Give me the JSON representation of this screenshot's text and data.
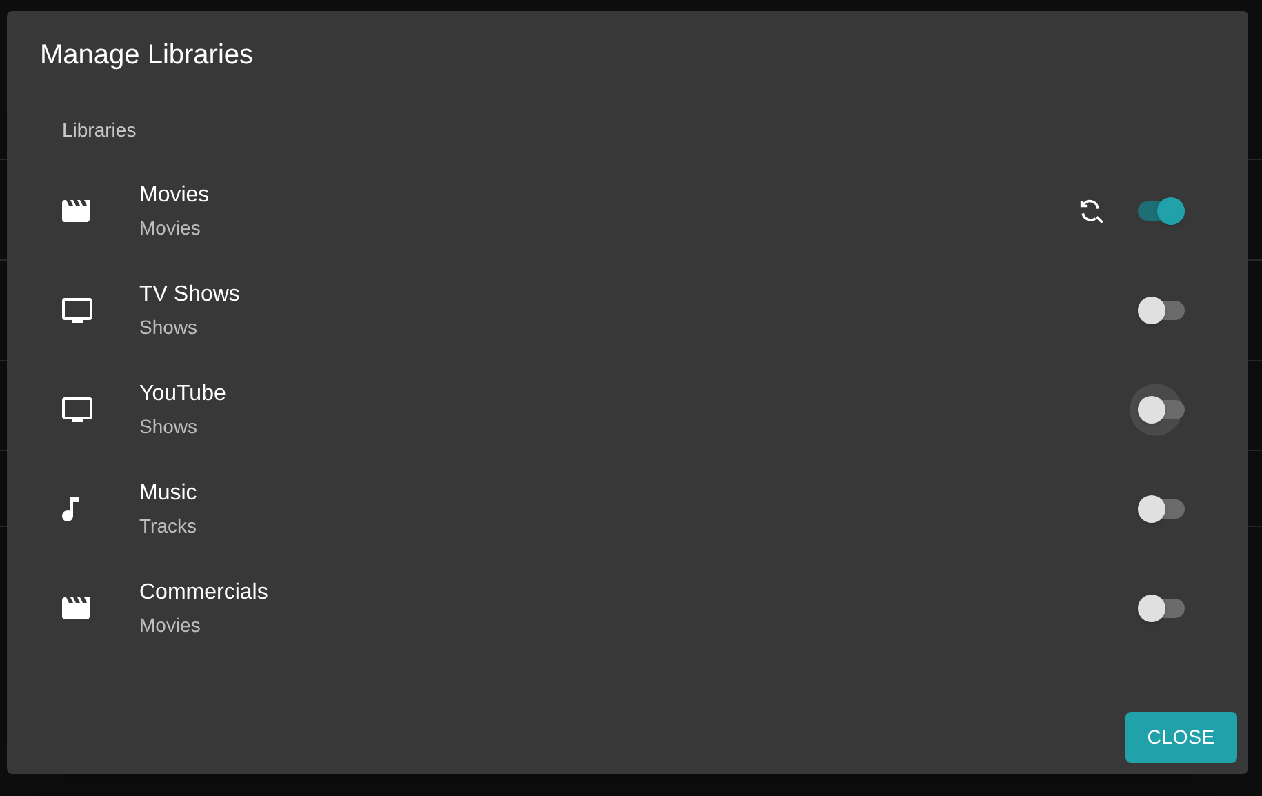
{
  "dialog": {
    "title": "Manage Libraries",
    "section_label": "Libraries",
    "libraries": [
      {
        "kind": "movies",
        "name": "Movies",
        "type": "Movies",
        "on": true,
        "focused": false,
        "scan_button": true
      },
      {
        "kind": "tv",
        "name": "TV Shows",
        "type": "Shows",
        "on": false,
        "focused": false,
        "scan_button": false
      },
      {
        "kind": "tv",
        "name": "YouTube",
        "type": "Shows",
        "on": false,
        "focused": true,
        "scan_button": false
      },
      {
        "kind": "music",
        "name": "Music",
        "type": "Tracks",
        "on": false,
        "focused": false,
        "scan_button": false
      },
      {
        "kind": "movies",
        "name": "Commercials",
        "type": "Movies",
        "on": false,
        "focused": false,
        "scan_button": false
      }
    ],
    "close_button": "CLOSE"
  }
}
